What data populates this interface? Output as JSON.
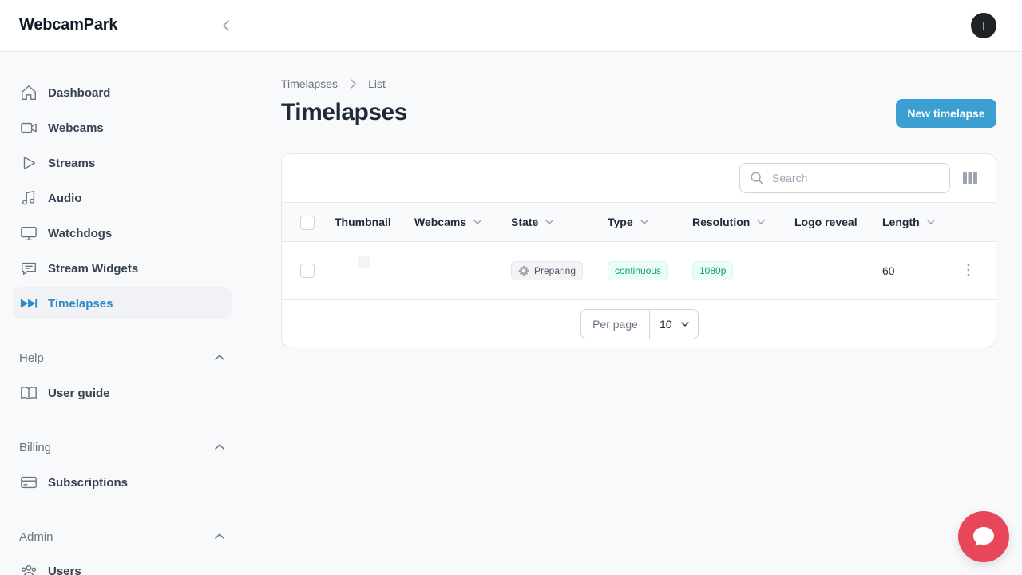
{
  "app": {
    "brand": "WebcamPark",
    "avatar_initial": "I"
  },
  "sidebar": {
    "items": [
      {
        "label": "Dashboard",
        "icon": "home-icon"
      },
      {
        "label": "Webcams",
        "icon": "video-camera-icon"
      },
      {
        "label": "Streams",
        "icon": "play-icon"
      },
      {
        "label": "Audio",
        "icon": "music-note-icon"
      },
      {
        "label": "Watchdogs",
        "icon": "monitor-icon"
      },
      {
        "label": "Stream Widgets",
        "icon": "chat-bubble-icon"
      },
      {
        "label": "Timelapses",
        "icon": "fast-forward-icon",
        "active": true
      }
    ],
    "groups": {
      "help": {
        "label": "Help",
        "items": [
          {
            "label": "User guide",
            "icon": "book-icon"
          }
        ]
      },
      "billing": {
        "label": "Billing",
        "items": [
          {
            "label": "Subscriptions",
            "icon": "credit-card-icon"
          }
        ]
      },
      "admin": {
        "label": "Admin",
        "items": [
          {
            "label": "Users",
            "icon": "users-icon"
          }
        ]
      }
    }
  },
  "breadcrumb": {
    "root": "Timelapses",
    "current": "List"
  },
  "page": {
    "title": "Timelapses",
    "new_button": "New timelapse"
  },
  "table": {
    "search_placeholder": "Search",
    "columns": {
      "thumbnail": "Thumbnail",
      "webcams": "Webcams",
      "state": "State",
      "type": "Type",
      "resolution": "Resolution",
      "logo_reveal": "Logo reveal",
      "length": "Length"
    },
    "rows": [
      {
        "state": "Preparing",
        "type": "continuous",
        "resolution": "1080p",
        "length": "60"
      }
    ],
    "pagination": {
      "per_page_label": "Per page",
      "per_page_value": "10"
    }
  },
  "colors": {
    "accent": "#3b9fd1",
    "active_nav": "#2a8cc9",
    "chat": "#e8475b",
    "success": "#0f9f76"
  }
}
